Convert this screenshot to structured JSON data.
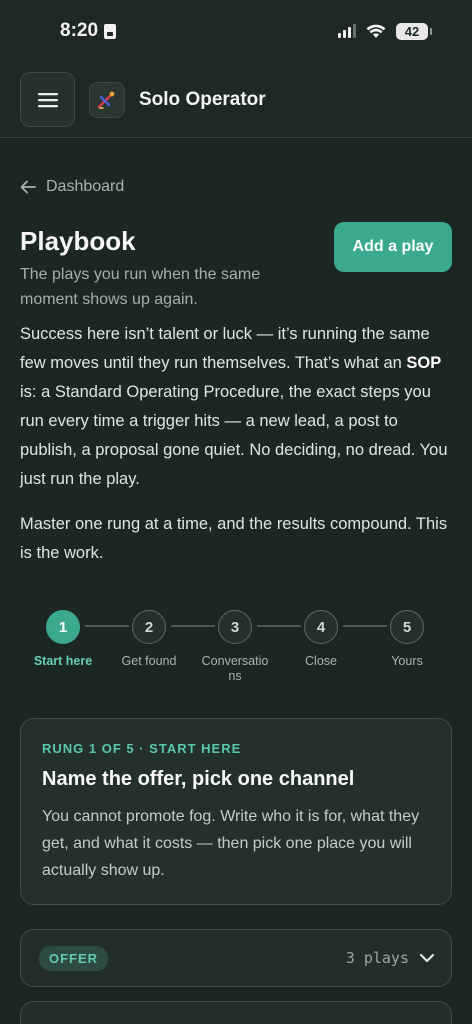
{
  "status": {
    "time": "8:20",
    "battery": "42"
  },
  "app": {
    "name": "Solo Operator"
  },
  "breadcrumb": {
    "label": "Dashboard"
  },
  "page": {
    "title": "Playbook",
    "add_label": "Add a play",
    "subtitle": "The plays you run when the same moment shows up again.",
    "intro_before": "Success here isn’t talent or luck — it’s running the same few moves until they run themselves. That’s what an ",
    "intro_bold": "SOP",
    "intro_after": " is: a Standard Operating Procedure, the exact steps you run every time a trigger hits — a new lead, a post to publish, a proposal gone quiet. No deciding, no dread. You just run the play.",
    "intro2": "Master one rung at a time, and the results compound. This is the work."
  },
  "steps": [
    {
      "num": "1",
      "label": "Start here"
    },
    {
      "num": "2",
      "label": "Get found"
    },
    {
      "num": "3",
      "label": "Conversatio ns"
    },
    {
      "num": "4",
      "label": "Close"
    },
    {
      "num": "5",
      "label": "Yours"
    }
  ],
  "rung": {
    "eyebrow": "RUNG 1 OF 5 · START HERE",
    "title": "Name the offer, pick one channel",
    "desc": "You cannot promote fog. Write who it is for, what they get, and what it costs — then pick one place you will actually show up."
  },
  "groups": [
    {
      "tag": "OFFER",
      "count": "3 plays"
    }
  ],
  "colors": {
    "accent": "#3aa98f",
    "background": "#1c2622"
  },
  "icons": [
    "menu-icon",
    "brand-logo-icon",
    "arrow-left-icon",
    "chevron-down-icon"
  ]
}
